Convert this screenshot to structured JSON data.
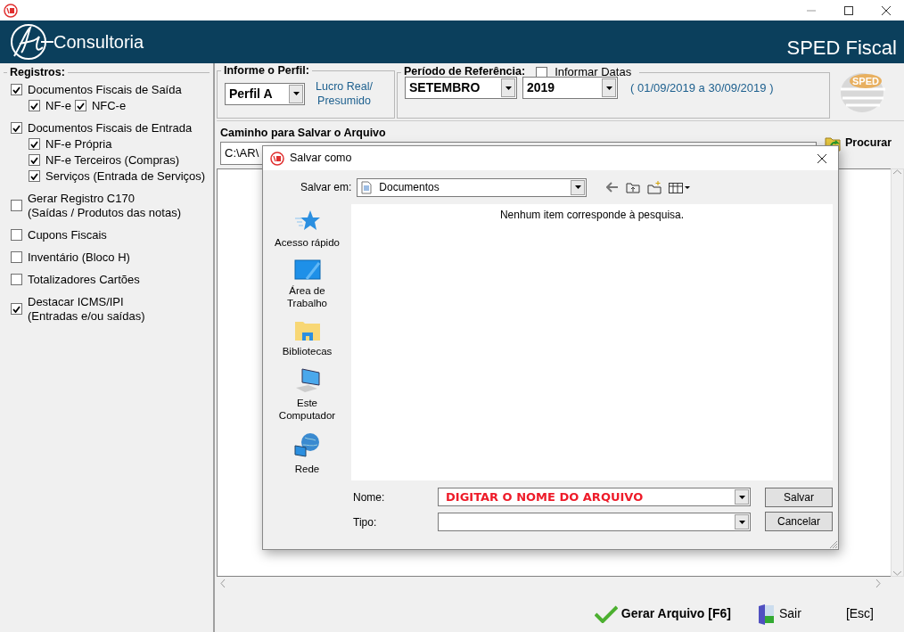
{
  "header": {
    "brand": "Consultoria",
    "title": "SPED Fiscal"
  },
  "registros": {
    "title": "Registros:",
    "items": [
      {
        "label": "Documentos Fiscais de Saída",
        "checked": true,
        "kind": "inline",
        "children": [
          {
            "label": "NF-e",
            "checked": true
          },
          {
            "label": "NFC-e",
            "checked": true
          }
        ]
      },
      {
        "label": "Documentos Fiscais de Entrada",
        "checked": true,
        "kind": "stacked",
        "children": [
          {
            "label": "NF-e Própria",
            "checked": true
          },
          {
            "label": "NF-e Terceiros (Compras)",
            "checked": true
          },
          {
            "label": "Serviços (Entrada de Serviços)",
            "checked": true
          }
        ]
      },
      {
        "label": "Gerar Registro C170",
        "sublabel": "(Saídas / Produtos das notas)",
        "checked": false
      },
      {
        "label": "Cupons Fiscais",
        "checked": false
      },
      {
        "label": "Inventário (Bloco H)",
        "checked": false
      },
      {
        "label": "Totalizadores Cartões",
        "checked": false
      },
      {
        "label": "Destacar ICMS/IPI",
        "sublabel": "(Entradas e/ou saídas)",
        "checked": true
      }
    ]
  },
  "perfil": {
    "title": "Informe o Perfil:",
    "value": "Perfil A",
    "regime_lines": [
      "Lucro Real/",
      "Presumido"
    ]
  },
  "periodo": {
    "title": "Período de Referência:",
    "informar_datas": {
      "label": "Informar Datas",
      "checked": false
    },
    "month": "SETEMBRO",
    "year": "2019",
    "range": "( 01/09/2019 a 30/09/2019 )"
  },
  "logo_text": "SPED",
  "caminho": {
    "label": "Caminho para Salvar o Arquivo",
    "value": "C:\\AR\\",
    "button": "Procurar"
  },
  "footer": {
    "buttons": [
      {
        "label": "Gerar Arquivo [F6]",
        "kind": "generate"
      },
      {
        "label": "Sair",
        "kind": "exit"
      }
    ],
    "shortcut": "[Esc]"
  },
  "dialog": {
    "title": "Salvar como",
    "save_in_label": "Salvar em:",
    "save_in": "Documentos",
    "places": [
      {
        "label": "Acesso rápido",
        "kind": "star"
      },
      {
        "label": "Área de Trabalho",
        "kind": "desktop"
      },
      {
        "label": "Bibliotecas",
        "kind": "libraries"
      },
      {
        "label": "Este Computador",
        "kind": "computer"
      },
      {
        "label": "Rede",
        "kind": "network"
      }
    ],
    "empty_message": "Nenhum item corresponde à pesquisa.",
    "name_label": "Nome:",
    "name_value": "DIGITAR O NOME DO ARQUIVO",
    "type_label": "Tipo:",
    "buttons": [
      "Salvar",
      "Cancelar"
    ]
  }
}
